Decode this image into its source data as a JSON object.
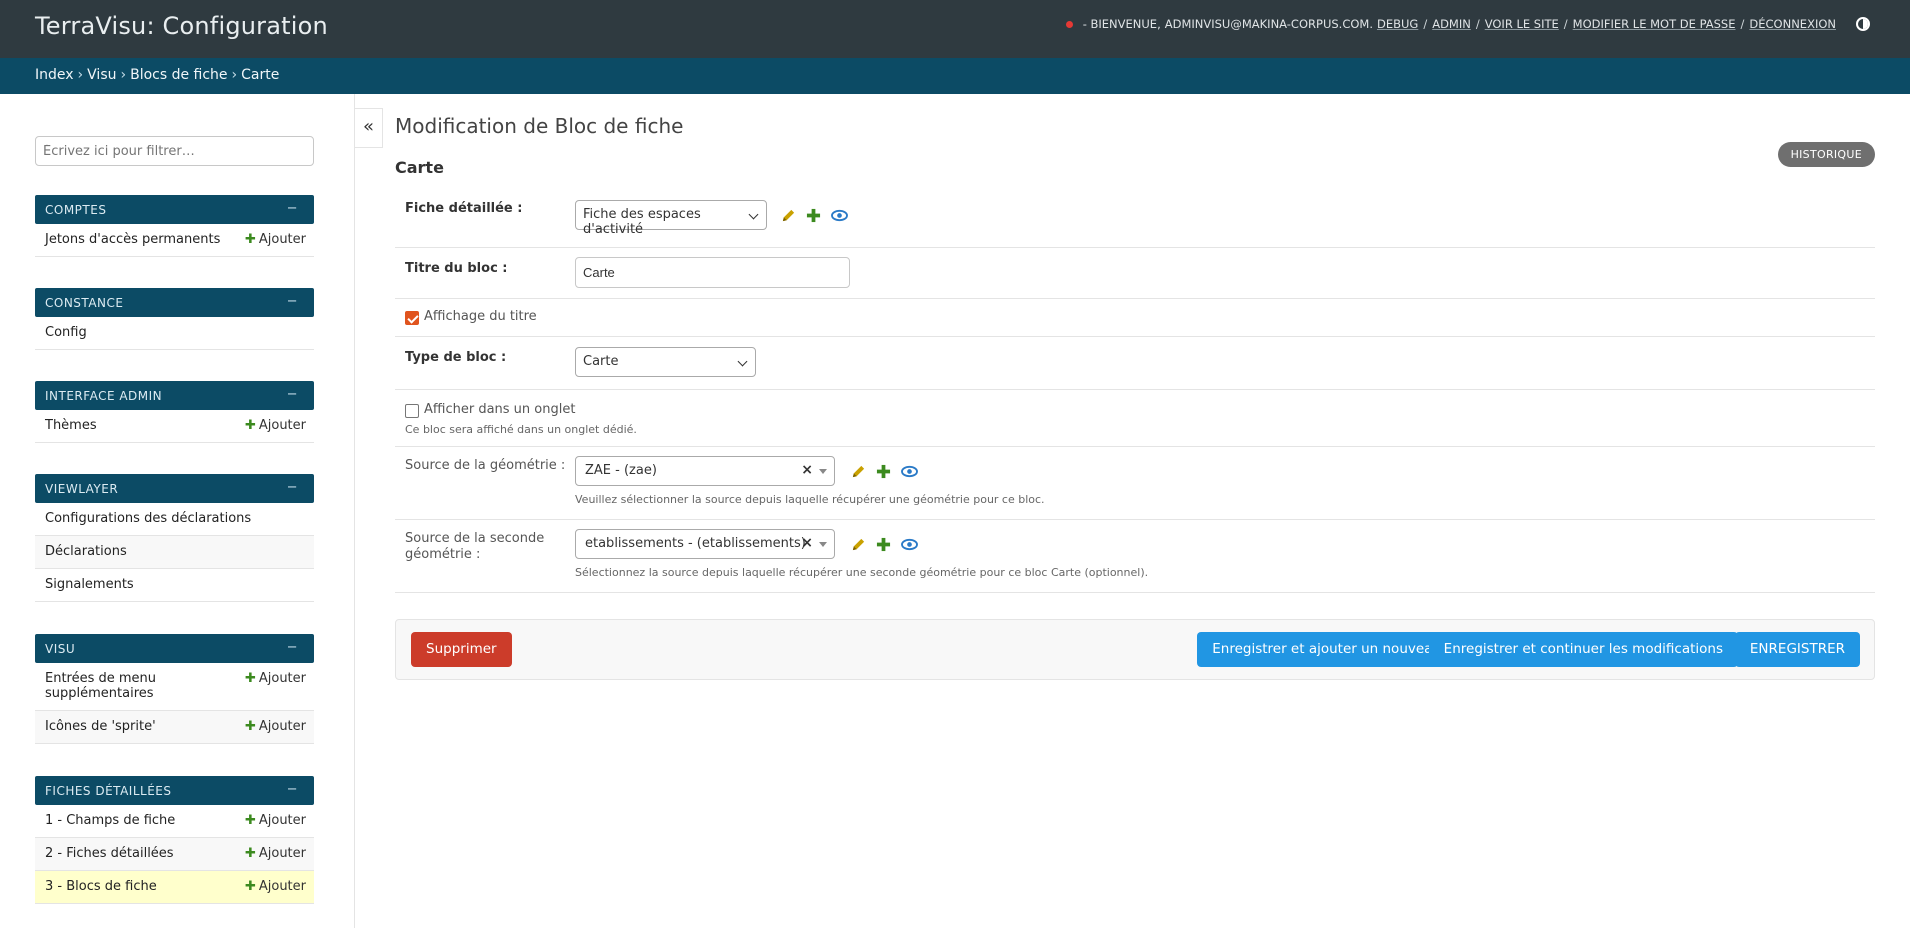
{
  "header": {
    "branding": "TerraVisu: Configuration",
    "welcome": "- Bienvenue, ",
    "user": "adminvisu@makina-corpus.com.",
    "links": [
      "Debug",
      "Admin",
      "Voir le site",
      "Modifier le mot de passe",
      "Déconnexion"
    ]
  },
  "breadcrumbs": [
    "Index",
    "Visu",
    "Blocs de fiche",
    "Carte"
  ],
  "sidebar": {
    "filter_placeholder": "Écrivez ici pour filtrer…",
    "collapse_symbol": "«",
    "add_label": "Ajouter",
    "modules": [
      {
        "name": "Comptes",
        "items": [
          {
            "label": "Jetons d'accès permanents",
            "add": true
          }
        ]
      },
      {
        "name": "Constance",
        "items": [
          {
            "label": "Config",
            "add": false
          }
        ]
      },
      {
        "name": "Interface Admin",
        "items": [
          {
            "label": "Thèmes",
            "add": true
          }
        ]
      },
      {
        "name": "ViewLayer",
        "items": [
          {
            "label": "Configurations des déclarations",
            "add": false
          },
          {
            "label": "Déclarations",
            "add": false
          },
          {
            "label": "Signalements",
            "add": false
          }
        ]
      },
      {
        "name": "Visu",
        "items": [
          {
            "label": "Entrées de menu supplémentaires",
            "add": true
          },
          {
            "label": "Icônes de 'sprite'",
            "add": true
          }
        ]
      },
      {
        "name": "Fiches détaillées",
        "items": [
          {
            "label": "1 - Champs de fiche",
            "add": true
          },
          {
            "label": "2 - Fiches détaillées",
            "add": true
          },
          {
            "label": "3 - Blocs de fiche",
            "add": true,
            "current": true
          }
        ]
      }
    ]
  },
  "content": {
    "page_title": "Modification de Bloc de fiche",
    "history_button": "Historique",
    "object_title": "Carte",
    "fields": {
      "fiche": {
        "label": "Fiche détaillée :",
        "value": "Fiche des espaces d'activité"
      },
      "titre": {
        "label": "Titre du bloc :",
        "value": "Carte"
      },
      "affichage": {
        "label": "Affichage du titre",
        "checked": true
      },
      "type": {
        "label": "Type de bloc :",
        "value": "Carte"
      },
      "onglet": {
        "label": "Afficher dans un onglet",
        "checked": false,
        "help": "Ce bloc sera affiché dans un onglet dédié."
      },
      "source1": {
        "label": "Source de la géométrie :",
        "value": "ZAE - (zae)",
        "help": "Veuillez sélectionner la source depuis laquelle récupérer une géométrie pour ce bloc."
      },
      "source2": {
        "label": "Source de la seconde géométrie :",
        "value": "etablissements - (etablissements)",
        "help": "Sélectionnez la source depuis laquelle récupérer une seconde géométrie pour ce bloc Carte (optionnel)."
      }
    },
    "buttons": {
      "delete": "Supprimer",
      "save_add": "Enregistrer et ajouter un nouveau",
      "save_continue": "Enregistrer et continuer les modifications",
      "save": "ENREGISTRER"
    }
  },
  "colors": {
    "header_bg": "#2f3a40",
    "breadcrumb_bg": "#0c4b65",
    "accent_blue": "#2196e3",
    "delete_red": "#cc3c2a",
    "add_green": "#3c8a1f",
    "edit_yellow": "#c9a100",
    "view_blue": "#2a7ac7",
    "current_row": "#ffffcc"
  },
  "icons": {
    "edit": "pencil-icon",
    "add": "plus-icon",
    "view": "eye-icon",
    "theme": "contrast-icon"
  }
}
